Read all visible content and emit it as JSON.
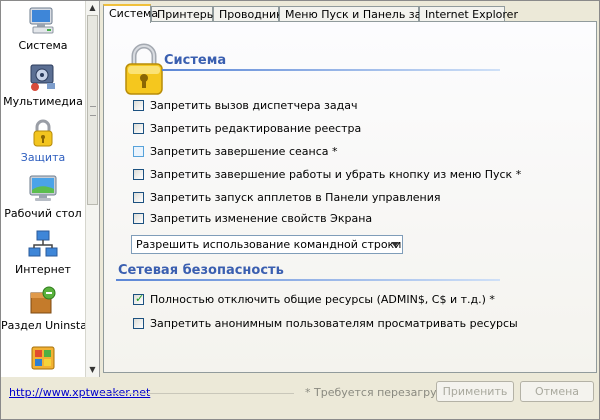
{
  "sidebar": {
    "items": [
      {
        "label": "Система",
        "icon": "computer-icon"
      },
      {
        "label": "Мультимедиа",
        "icon": "multimedia-icon"
      },
      {
        "label": "Защита",
        "icon": "lock-icon"
      },
      {
        "label": "Рабочий стол",
        "icon": "desktop-icon"
      },
      {
        "label": "Интернет",
        "icon": "network-icon"
      },
      {
        "label": "Раздел Uninstall",
        "icon": "uninstall-icon"
      },
      {
        "label": "",
        "icon": "programs-icon"
      }
    ]
  },
  "tabs": [
    {
      "label": "Система",
      "active": true
    },
    {
      "label": "Принтеры"
    },
    {
      "label": "Проводник"
    },
    {
      "label": "Меню Пуск и Панель задач"
    },
    {
      "label": "Internet Explorer"
    }
  ],
  "panel": {
    "section1_title": "Система",
    "checkboxes": [
      {
        "label": "Запретить вызов диспетчера задач",
        "checked": false
      },
      {
        "label": "Запретить редактирование реестра",
        "checked": false
      },
      {
        "label": "Запретить завершение сеанса *",
        "checked": false
      },
      {
        "label": "Запретить завершение работы и убрать кнопку из меню Пуск *",
        "checked": false
      },
      {
        "label": "Запретить запуск апплетов в Панели управления",
        "checked": false
      },
      {
        "label": "Запретить изменение свойств Экрана",
        "checked": false
      }
    ],
    "dropdown": {
      "selected": "Разрешить использование командной строки"
    },
    "section2_title": "Сетевая безопасность",
    "net_checkboxes": [
      {
        "label": "Полностью отключить общие ресурсы (ADMIN$, C$ и т.д.) *",
        "checked": true
      },
      {
        "label": "Запретить анонимным пользователям просматривать ресурсы",
        "checked": false
      }
    ]
  },
  "footer": {
    "link": "http://www.xptweaker.net",
    "note": "* Требуется перезагрузка",
    "apply_label": "Применить",
    "cancel_label": "Отмена"
  },
  "colors": {
    "accent": "#3a5fb0",
    "check": "#21a121",
    "tab_highlight": "#f0c03c"
  }
}
